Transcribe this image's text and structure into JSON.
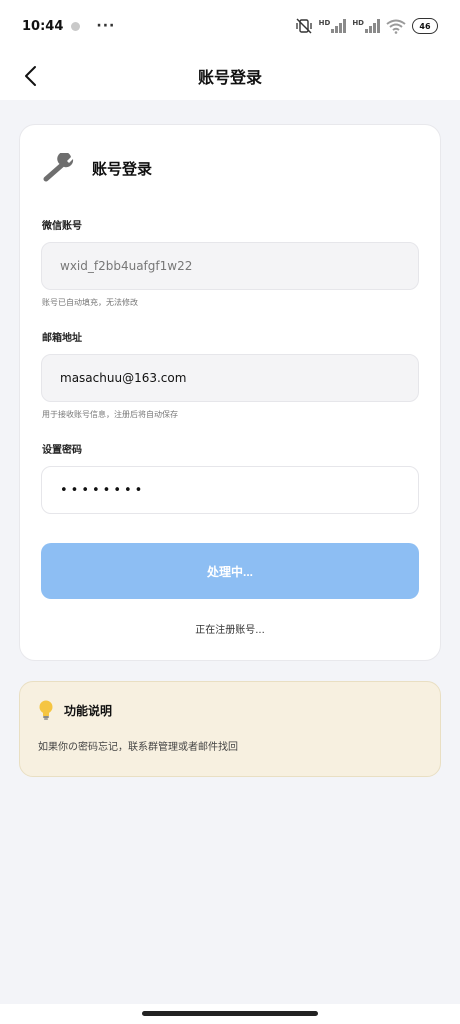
{
  "status_bar": {
    "time": "10:44",
    "more": "···",
    "hd_1": "HD",
    "hd_2": "HD",
    "battery": "46"
  },
  "nav": {
    "title": "账号登录"
  },
  "login_card": {
    "title": "账号登录",
    "wechat_label": "微信账号",
    "wechat_value": "wxid_f2bb4uafgf1w22",
    "wechat_hint": "账号已自动填充，无法修改",
    "email_label": "邮箱地址",
    "email_value": "masachuu@163.com",
    "email_hint": "用于接收账号信息，注册后将自动保存",
    "password_label": "设置密码",
    "password_value": "••••••••",
    "submit_label": "处理中...",
    "processing_text": "正在注册账号..."
  },
  "info_card": {
    "title": "功能说明",
    "text": "如果你の密码忘记，联系群管理或者邮件找回"
  },
  "colors": {
    "accent_button": "#8dbef3",
    "info_background": "#f7f0e0",
    "page_background": "#f3f4f8"
  }
}
